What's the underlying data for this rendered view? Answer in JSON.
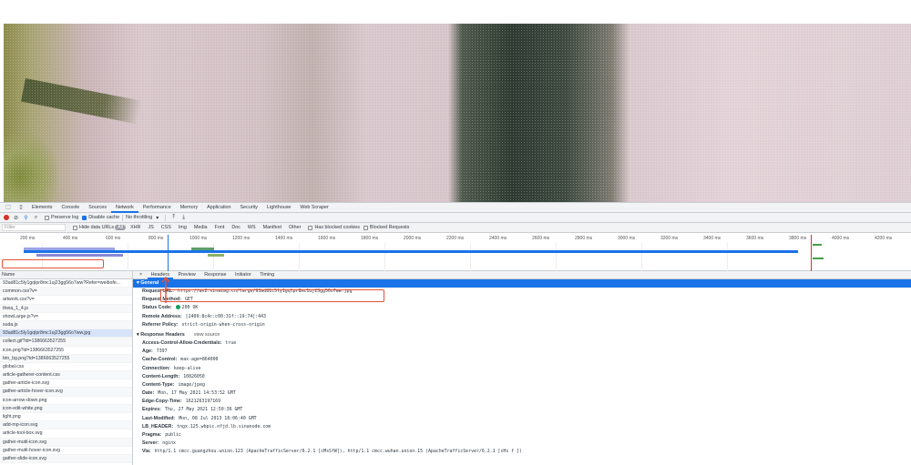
{
  "devtools": {
    "tabs": [
      "Elements",
      "Console",
      "Sources",
      "Network",
      "Performance",
      "Memory",
      "Application",
      "Security",
      "Lighthouse",
      "Web Scraper"
    ],
    "active_tab": "Network",
    "toolbar": {
      "preserve_log": "Preserve log",
      "disable_cache": "Disable cache",
      "throttling": "No throttling"
    },
    "filter": {
      "placeholder": "Filter",
      "hide_data_urls": "Hide data URLs",
      "types": [
        "All",
        "XHR",
        "JS",
        "CSS",
        "Img",
        "Media",
        "Font",
        "Doc",
        "WS",
        "Manifest",
        "Other"
      ],
      "has_blocked_cookies": "Has blocked cookies",
      "blocked_requests": "Blocked Requests"
    },
    "overview_ticks": [
      "200 ms",
      "400 ms",
      "600 ms",
      "800 ms",
      "1000 ms",
      "1200 ms",
      "1400 ms",
      "1600 ms",
      "1800 ms",
      "2000 ms",
      "2200 ms",
      "2400 ms",
      "2600 ms",
      "2800 ms",
      "3000 ms",
      "3200 ms",
      "3400 ms",
      "3600 ms",
      "3800 ms",
      "4000 ms",
      "4200 ms"
    ],
    "request_list": {
      "header": "Name",
      "rows": [
        "93ad81c5ly1gqlpr8mc1uj23gg56o7ww?Refer=weibofe...",
        "common.css?v=",
        "artwork.css?v=",
        "theia_1_4.js",
        "showLarge.js?v=",
        "suda.js",
        "93ad81c5ly1gqlpr8mc1uj23gg56o7ww.jpg",
        "collect.gif?id=1386663527255",
        "icon.png?id=1386663527255",
        "btn_bg.png?id=1386663527255",
        "global.css",
        "article-gatherer-content.css",
        "gather-article-icon.svg",
        "gather-article-hover-icon.svg",
        "icon-arrow-down.png",
        "icon-edit-white.png",
        "light.png",
        "add-mp-icon.svg",
        "article-tool-box.svg",
        "gather-mutil-icon.svg",
        "gather-mutil-hover-icon.svg",
        "gather-slide-icon.svg"
      ],
      "selected_index": 6
    },
    "details": {
      "tabs": [
        "Headers",
        "Preview",
        "Response",
        "Initiator",
        "Timing"
      ],
      "active_tab": "Headers",
      "close": "×",
      "general_title": "General",
      "general": [
        {
          "key": "Request URL:",
          "value": "https://wx2.sinaimg.cn/large/93ad81c5ly1gqlpr8mc1uj23gg56o7ww.jpg"
        },
        {
          "key": "Request Method:",
          "value": "GET"
        },
        {
          "key": "Status Code:",
          "value": "200 OK"
        },
        {
          "key": "Remote Address:",
          "value": "[2409:8c4c:c00:31f::19:74]:443"
        },
        {
          "key": "Referrer Policy:",
          "value": "strict-origin-when-cross-origin"
        }
      ],
      "response_title": "Response Headers",
      "view_source": "view source",
      "response": [
        {
          "key": "Access-Control-Allow-Credentials:",
          "value": "true"
        },
        {
          "key": "Age:",
          "value": "7397"
        },
        {
          "key": "Cache-Control:",
          "value": "max-age=864000"
        },
        {
          "key": "Connection:",
          "value": "keep-alive"
        },
        {
          "key": "Content-Length:",
          "value": "10826050"
        },
        {
          "key": "Content-Type:",
          "value": "image/jpeg"
        },
        {
          "key": "Date:",
          "value": "Mon, 17 May 2021 14:53:52 GMT"
        },
        {
          "key": "Edge-Copy-Time:",
          "value": "1621263197169"
        },
        {
          "key": "Expires:",
          "value": "Thu, 27 May 2021 12:50:36 GMT"
        },
        {
          "key": "Last-Modified:",
          "value": "Mon, 08 Jul 2013 18:06:40 GMT"
        },
        {
          "key": "LB_HEADER:",
          "value": "tngx.125.wbpic.nfjd.lb.sinanode.com"
        },
        {
          "key": "Pragma:",
          "value": "public"
        },
        {
          "key": "Server:",
          "value": "nginx"
        },
        {
          "key": "Via:",
          "value": "http/1.1 cmcc.guangzhou.union.123 (ApacheTrafficServer/6.2.1 [cMsSfW]), http/1.1 cmcc.wuhan.union.15 (ApacheTrafficServer/6.2.1 [cHs f ])"
        }
      ]
    }
  }
}
